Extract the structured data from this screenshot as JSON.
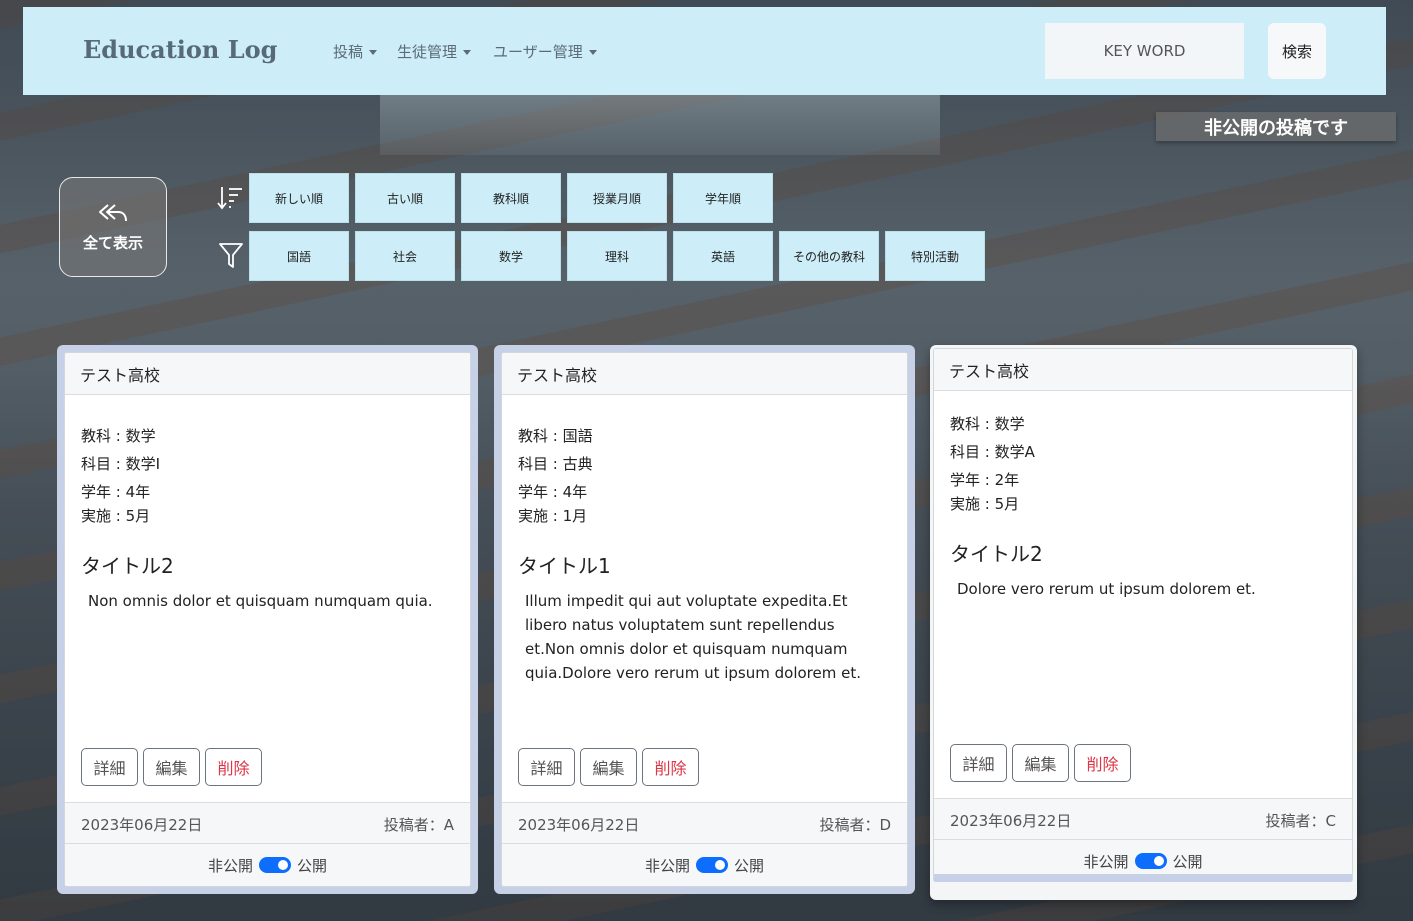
{
  "navbar": {
    "brand": "Education Log",
    "menus": [
      "投稿",
      "生徒管理",
      "ユーザー管理"
    ],
    "search_placeholder": "KEY WORD",
    "search_button": "検索"
  },
  "notice": "非公開の投稿です",
  "show_all": {
    "label": "全て表示",
    "icon": "reply-all-icon"
  },
  "sort_chips": [
    "新しい順",
    "古い順",
    "教科順",
    "授業月順",
    "学年順"
  ],
  "filter_chips": [
    "国語",
    "社会",
    "数学",
    "理科",
    "英語",
    "その他の教科",
    "特別活動"
  ],
  "cards": [
    {
      "school": "テスト高校",
      "subject": "教科 : 数学",
      "course": "科目 : 数学I",
      "grade": "学年 : 4年",
      "month": "実施 : 5月",
      "title": "タイトル2",
      "body": "Non omnis dolor et quisquam numquam quia.",
      "btn_detail": "詳細",
      "btn_edit": "編集",
      "btn_delete": "削除",
      "date": "2023年06月22日",
      "author": "投稿者：A",
      "private": "非公開",
      "public": "公開"
    },
    {
      "school": "テスト高校",
      "subject": "教科 : 国語",
      "course": "科目 : 古典",
      "grade": "学年 : 4年",
      "month": "実施 : 1月",
      "title": "タイトル1",
      "body": "Illum impedit qui aut voluptate expedita.Et libero natus voluptatem sunt repellendus et.Non omnis dolor et quisquam numquam quia.Dolore vero rerum ut ipsum dolorem et.",
      "btn_detail": "詳細",
      "btn_edit": "編集",
      "btn_delete": "削除",
      "date": "2023年06月22日",
      "author": "投稿者：D",
      "private": "非公開",
      "public": "公開"
    },
    {
      "school": "テスト高校",
      "subject": "教科 : 数学",
      "course": "科目 : 数学A",
      "grade": "学年 : 2年",
      "month": "実施 : 5月",
      "title": "タイトル2",
      "body": "Dolore vero rerum ut ipsum dolorem et.",
      "btn_detail": "詳細",
      "btn_edit": "編集",
      "btn_delete": "削除",
      "date": "2023年06月22日",
      "author": "投稿者：C",
      "private": "非公開",
      "public": "公開"
    }
  ]
}
